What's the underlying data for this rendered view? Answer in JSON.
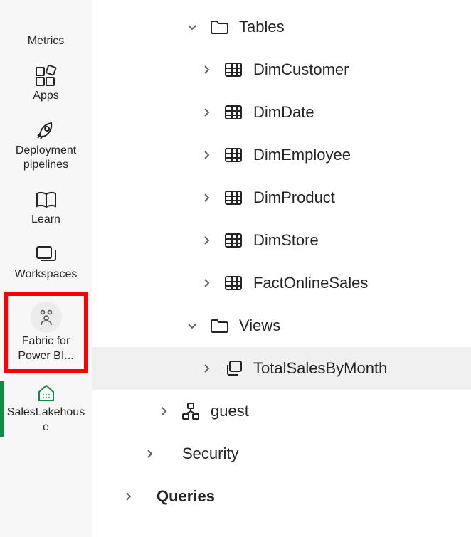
{
  "sidebar": {
    "items": [
      {
        "label": "Metrics",
        "icon": "metrics"
      },
      {
        "label": "Apps",
        "icon": "apps"
      },
      {
        "label": "Deployment pipelines",
        "icon": "rocket"
      },
      {
        "label": "Learn",
        "icon": "book"
      },
      {
        "label": "Workspaces",
        "icon": "workspaces"
      },
      {
        "label": "Fabric for Power BI...",
        "icon": "people",
        "highlighted": true
      },
      {
        "label": "SalesLakehouse",
        "icon": "lakehouse",
        "selected": true
      }
    ]
  },
  "tree": {
    "tables": {
      "label": "Tables",
      "children": [
        "DimCustomer",
        "DimDate",
        "DimEmployee",
        "DimProduct",
        "DimStore",
        "FactOnlineSales"
      ]
    },
    "views": {
      "label": "Views",
      "children": [
        "TotalSalesByMonth"
      ]
    },
    "guest_label": "guest",
    "security_label": "Security",
    "queries_label": "Queries"
  }
}
